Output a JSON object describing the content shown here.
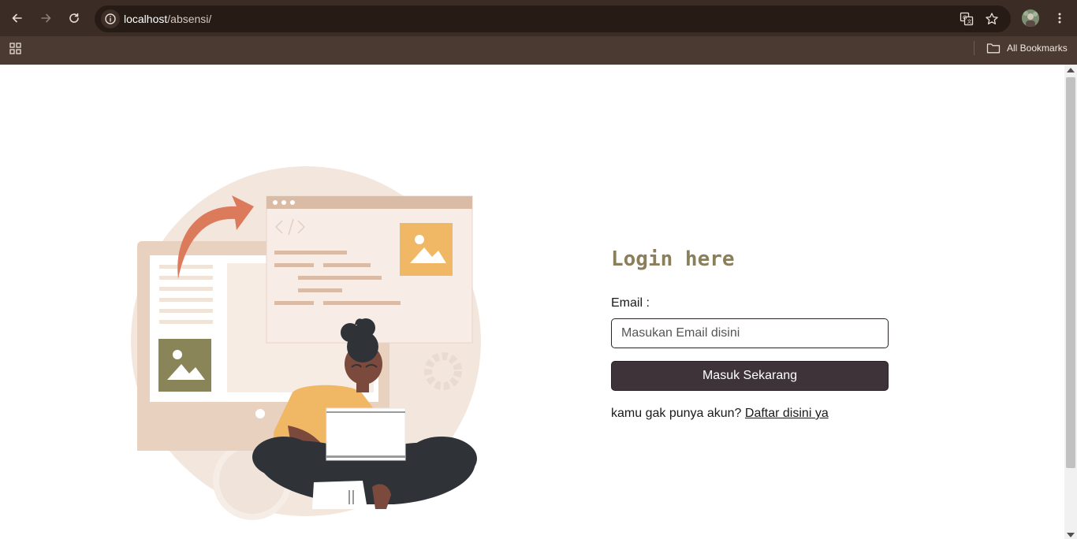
{
  "browser": {
    "url_host": "localhost",
    "url_path": "/absensi/",
    "all_bookmarks_label": "All Bookmarks",
    "accent_color": "#3b2c25"
  },
  "icons": {
    "back": "back-arrow-icon",
    "forward": "forward-arrow-icon",
    "reload": "reload-icon",
    "site_info": "site-info-icon",
    "translate": "translate-icon",
    "bookmark_star": "star-icon",
    "menu": "more-vertical-icon",
    "apps": "apps-grid-icon",
    "folder": "folder-icon"
  },
  "login": {
    "title": "Login here",
    "email_label": "Email :",
    "email_placeholder": "Masukan Email disini",
    "email_value": "",
    "submit_label": "Masuk Sekarang",
    "register_prompt": "kamu gak punya akun? ",
    "register_link": "Daftar disini ya",
    "title_color": "#8a7f5a",
    "button_color": "#3d3339"
  }
}
